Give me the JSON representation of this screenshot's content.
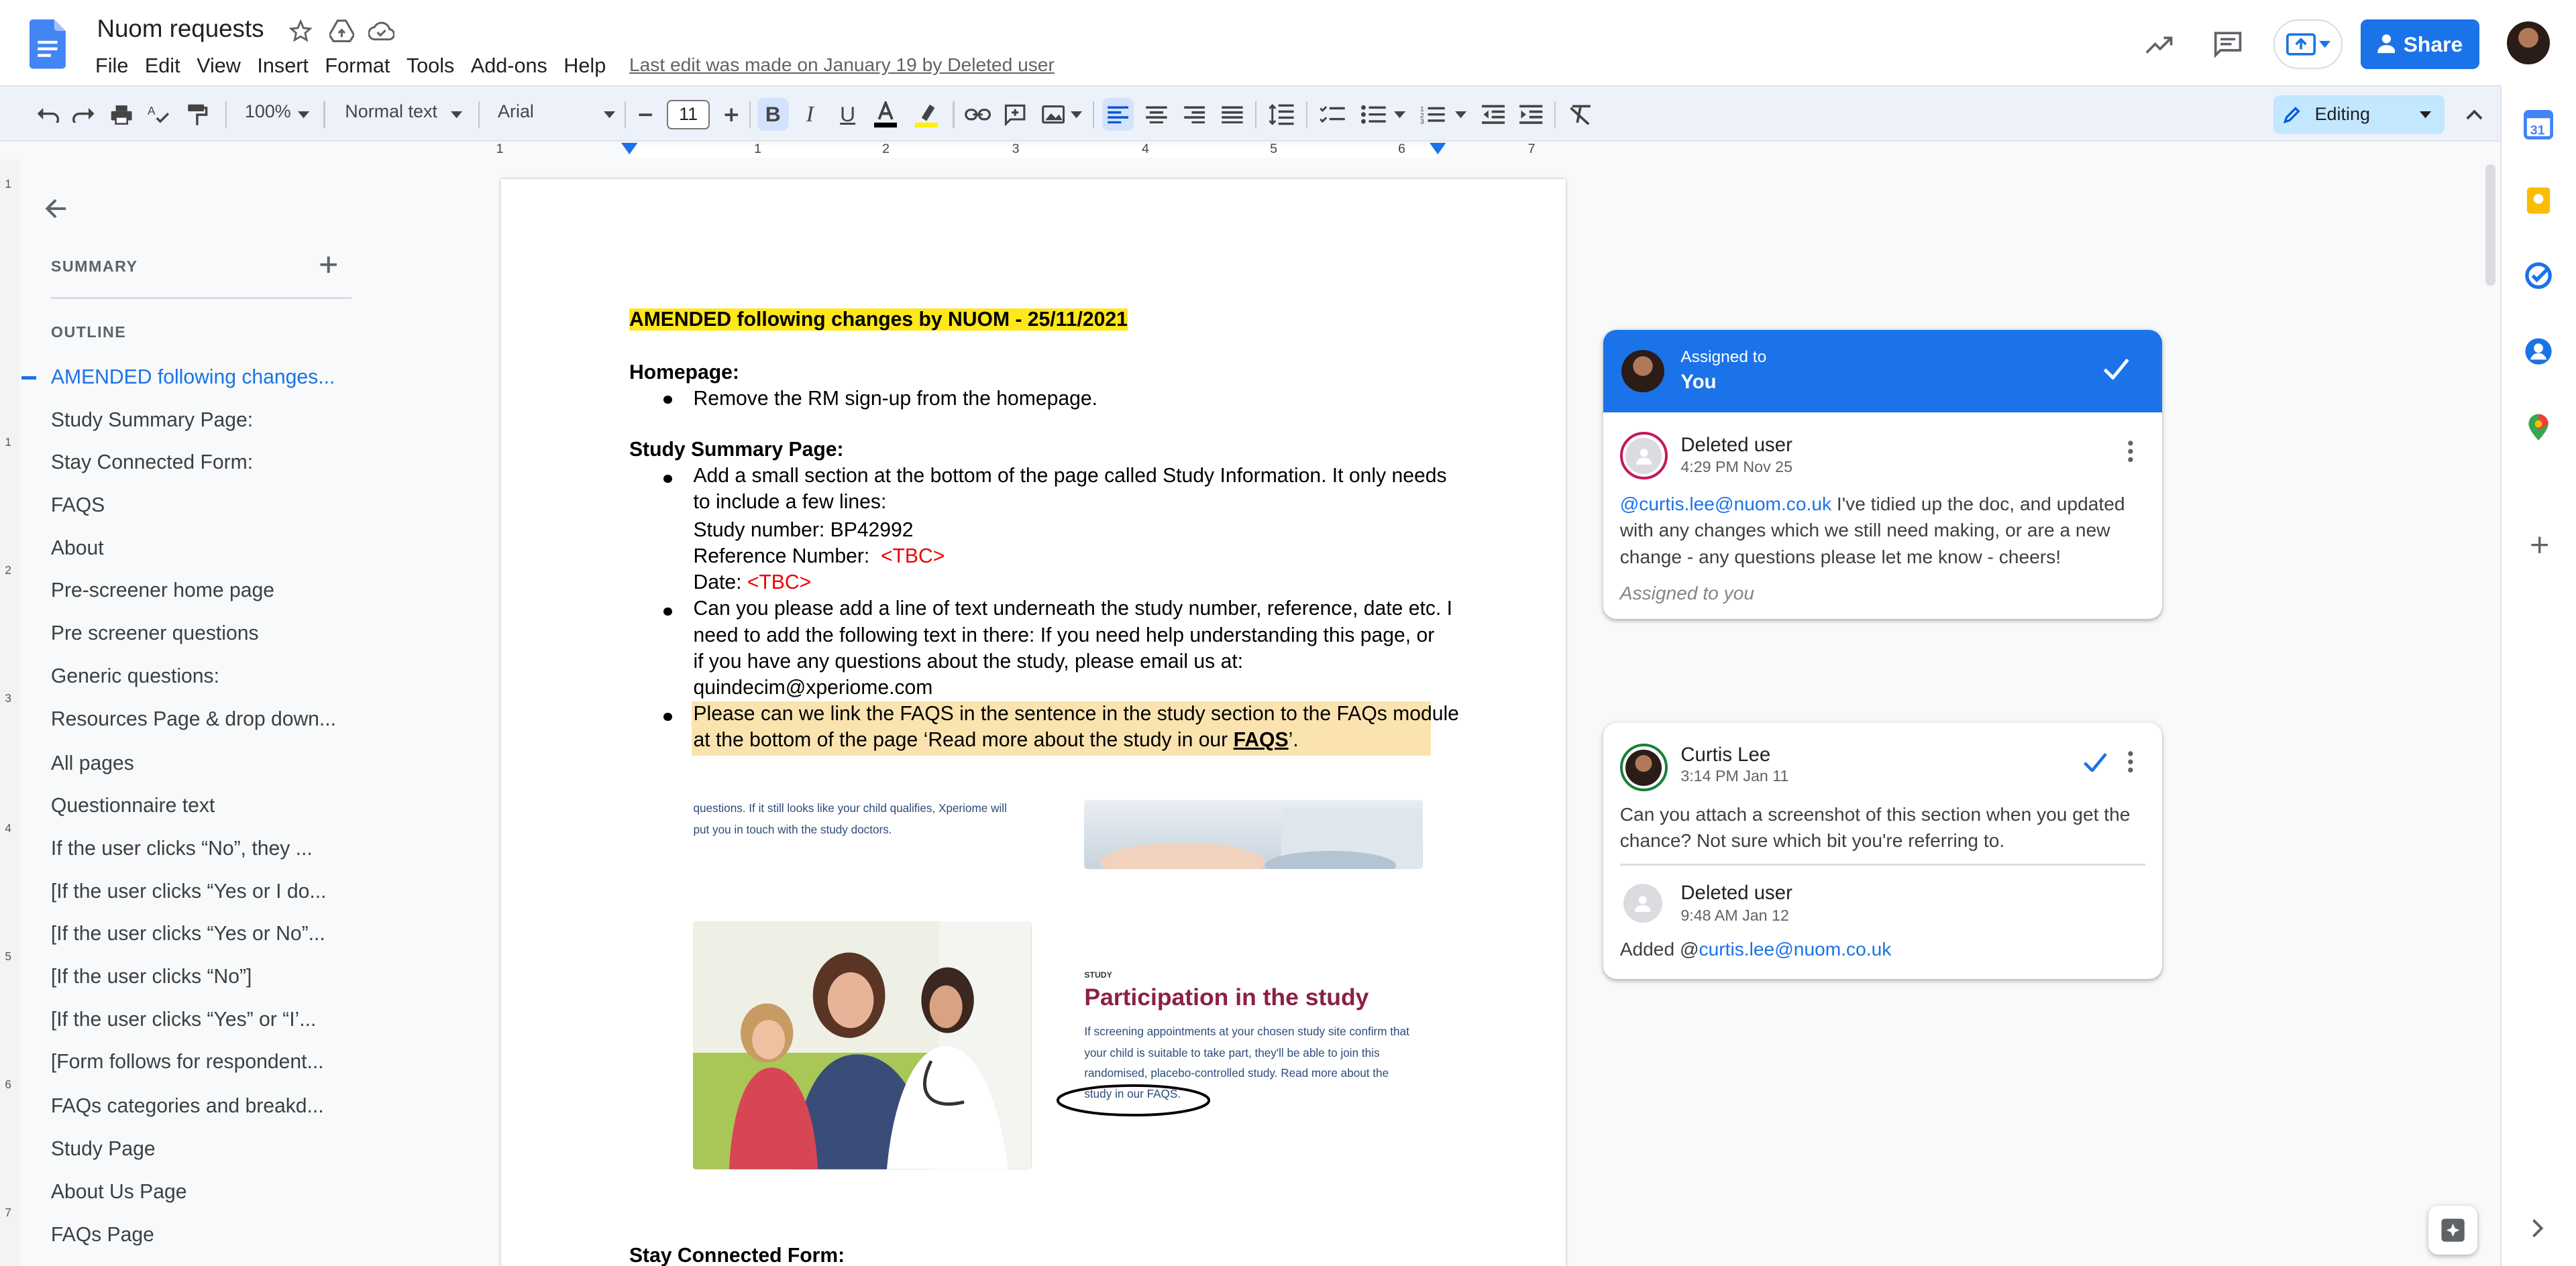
{
  "header": {
    "doc_title": "Nuom requests",
    "menus": [
      "File",
      "Edit",
      "View",
      "Insert",
      "Format",
      "Tools",
      "Add-ons",
      "Help"
    ],
    "last_edit": "Last edit was made on January 19 by Deleted user",
    "share_label": "Share"
  },
  "toolbar": {
    "zoom": "100%",
    "style": "Normal text",
    "font": "Arial",
    "font_size": "11",
    "mode": "Editing"
  },
  "ruler": {
    "numbers": [
      "1",
      "1",
      "2",
      "3",
      "4",
      "5",
      "6",
      "7"
    ]
  },
  "outline": {
    "summary_label": "SUMMARY",
    "outline_label": "OUTLINE",
    "items": [
      "AMENDED following changes...",
      "Study Summary Page:",
      "Stay Connected Form:",
      "FAQS",
      "About",
      "Pre-screener home page",
      "Pre screener questions",
      "Generic questions:",
      "Resources Page & drop down...",
      "All pages",
      "Questionnaire text",
      "If the user clicks “No”, they ...",
      "[If the user clicks “Yes or I do...",
      "[If the user clicks “Yes or No”...",
      "[If the user clicks “No”]",
      "[If the user clicks “Yes” or “I’...",
      "[Form follows for respondent...",
      "FAQs categories and breakd...",
      "Study Page",
      "About Us Page",
      "FAQs Page"
    ]
  },
  "document": {
    "amended_heading": "AMENDED following changes by NUOM - 25/11/2021",
    "homepage_heading": "Homepage:",
    "homepage_bullet": "Remove the RM sign-up from the homepage.",
    "study_heading": "Study Summary Page:",
    "bullet1_line1": "Add a small section at the bottom of the page called Study Information. It only needs",
    "bullet1_line2": "to include a few lines:",
    "study_number": "Study number: BP42992",
    "reference_label": "Reference Number:",
    "reference_value": "<TBC>",
    "date_label": "Date:",
    "date_value": "<TBC>",
    "bullet2_line1": "Can you please add a line of text underneath the study number, reference, date etc. I",
    "bullet2_line2": "need to add the following text in there: If you need help understanding this page, or",
    "bullet2_line3": "if you have any questions about the study, please email us at:",
    "bullet2_line4": "quindecim@xperiome.com",
    "bullet3_line1": "Please can we link the FAQS in the sentence in the study section to the FAQs module",
    "bullet3_line2a": "at the bottom of the page  ‘Read more about the study in our ",
    "bullet3_faqs": "FAQS",
    "bullet3_line2b": "’.",
    "shot_top_text_1": "questions. If it still looks like your child qualifies, Xperiome will",
    "shot_top_text_2": "put you in touch with the study doctors.",
    "shot_tag": "STUDY",
    "shot_title": "Participation in the study",
    "shot_body_1": "If screening appointments at your chosen study site confirm that",
    "shot_body_2": "your child is suitable to take part, they'll be able to join this",
    "shot_body_3": "randomised, placebo-controlled study. Read more about the",
    "shot_body_4": "study in our FAQS.",
    "next_heading": "Stay Connected Form:"
  },
  "comments": {
    "assigned_label": "Assigned to",
    "assigned_to": "You",
    "c1_author": "Deleted user",
    "c1_time": "4:29 PM Nov 25",
    "c1_mention": "@curtis.lee@nuom.co.uk",
    "c1_text_a": " I've tidied up the doc, and updated with any changes which we still need making, or are a new change  - any questions please let me know - cheers!",
    "c1_assigned": "Assigned to you",
    "c2_author": "Curtis Lee",
    "c2_time": "3:14 PM Jan 11",
    "c2_text": "Can you attach a screenshot of this section when you get the chance? Not sure which bit you're referring to.",
    "c3_author": "Deleted user",
    "c3_time": "9:48 AM Jan 12",
    "c3_prefix": "Added @",
    "c3_mention": "curtis.lee@nuom.co.uk"
  },
  "vruler": {
    "numbers": [
      "1",
      "1",
      "2",
      "3",
      "4",
      "5",
      "6",
      "7"
    ]
  },
  "colors": {
    "accent": "#1a73e8",
    "highlight_yellow": "#ffe71a",
    "highlight_orange": "#fbe3b0",
    "title_maroon": "#8b2043"
  }
}
